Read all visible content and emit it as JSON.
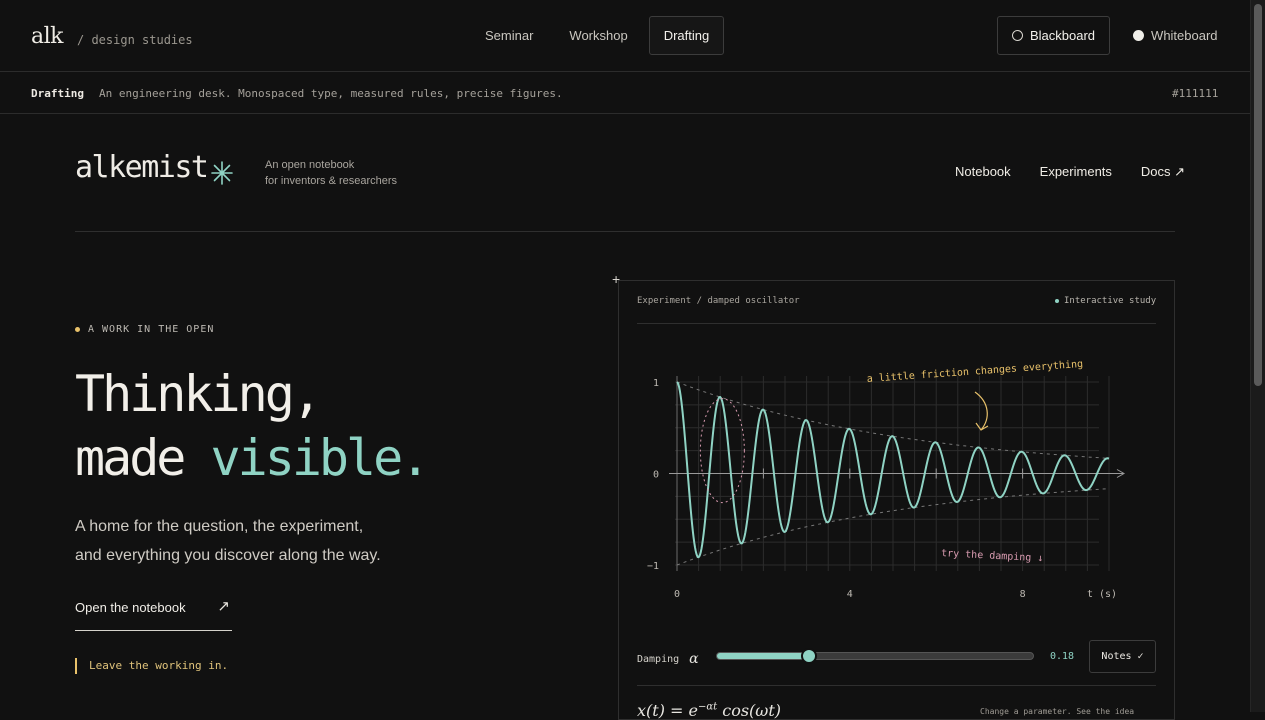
{
  "topbar": {
    "logo": "alk",
    "crumb": "/ design studies",
    "modes": [
      {
        "label": "Seminar"
      },
      {
        "label": "Workshop"
      },
      {
        "label": "Drafting"
      }
    ],
    "themes": [
      {
        "label": "Blackboard"
      },
      {
        "label": "Whiteboard"
      }
    ]
  },
  "infobar": {
    "title": "Drafting",
    "description": "An engineering desk. Monospaced type, measured rules, precise figures.",
    "hex": "#111111"
  },
  "site": {
    "brand": "alkemist",
    "tagline_1": "An open notebook",
    "tagline_2": "for inventors & researchers",
    "nav": [
      "Notebook",
      "Experiments",
      "Docs ↗"
    ]
  },
  "hero": {
    "kicker": "A WORK IN THE OPEN",
    "headline_1": "Thinking,",
    "headline_2a": "made ",
    "headline_2b": "visible.",
    "lede_1": "A home for the question, the experiment,",
    "lede_2": "and everything you discover along the way.",
    "cta": "Open the notebook",
    "cta_arrow": "↗",
    "motto": "Leave the working in."
  },
  "panel": {
    "title": "Experiment / damped oscillator",
    "badge": "Interactive study",
    "control_label": "Damping",
    "control_symbol": "α",
    "control_value": "0.18",
    "damping_fraction": 0.29,
    "notes_label": "Notes",
    "notes_icon": "check-icon",
    "formula": "x(t) = e",
    "formula_exp": "−αt",
    "formula_rest": " cos(ωt)",
    "hint": "Change a parameter. See the idea"
  },
  "chart_data": {
    "type": "line",
    "x_range": [
      0,
      10
    ],
    "y_range": [
      -1,
      1
    ],
    "xticks": [
      "0",
      "4",
      "8"
    ],
    "yticks": [
      "1",
      "0",
      "−1"
    ],
    "xlabel": "t (s)",
    "alpha": 0.18,
    "omega": 6.3,
    "annotation_top": "a little friction changes everything",
    "annotation_bottom": "try the damping ↓",
    "colors": {
      "curve": "#8fd3c4",
      "accent": "#e8c16a",
      "note_pink": "#d89bb0",
      "grid": "#2c2c2c"
    }
  }
}
